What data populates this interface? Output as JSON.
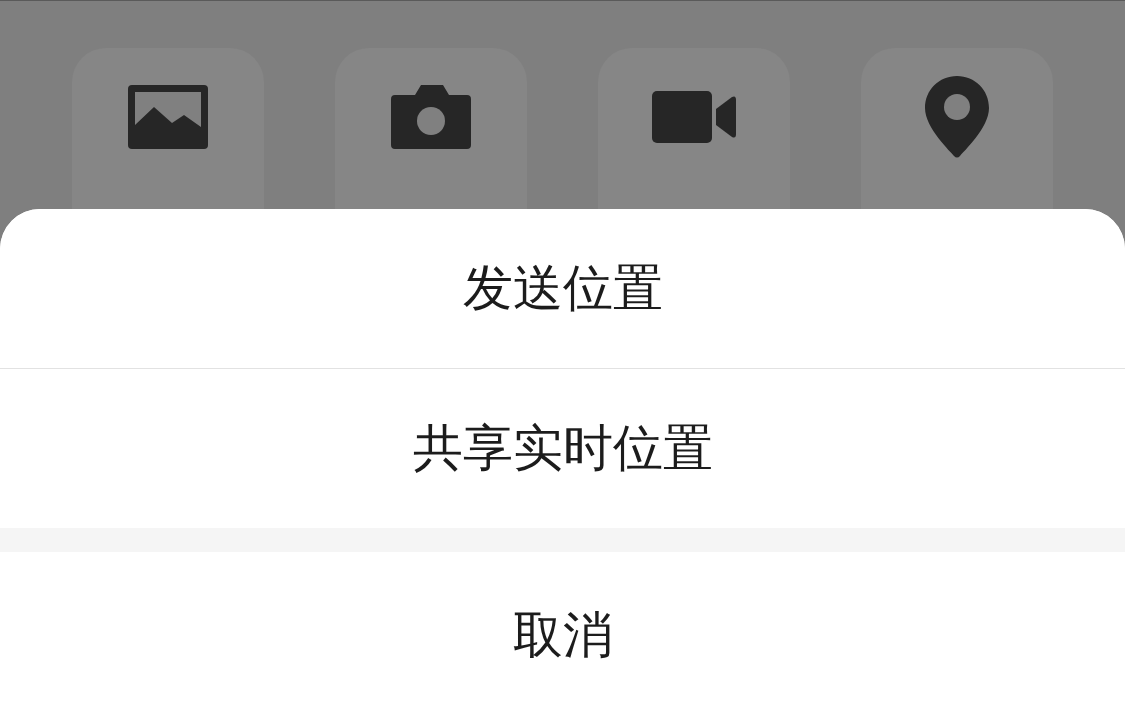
{
  "action_sheet": {
    "actions": [
      {
        "label": "发送位置"
      },
      {
        "label": "共享实时位置"
      }
    ],
    "cancel": {
      "label": "取消"
    }
  }
}
